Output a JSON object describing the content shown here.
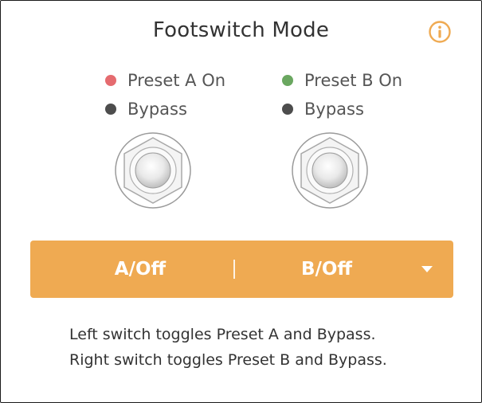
{
  "header": {
    "title": "Footswitch Mode",
    "info_icon": "info-circle-icon"
  },
  "switches": [
    {
      "states": [
        {
          "label": "Preset A On",
          "color": "#e56b6f"
        },
        {
          "label": "Bypass",
          "color": "#4d4d4d"
        }
      ],
      "icon": "footswitch-icon"
    },
    {
      "states": [
        {
          "label": "Preset B On",
          "color": "#6aa760"
        },
        {
          "label": "Bypass",
          "color": "#4d4d4d"
        }
      ],
      "icon": "footswitch-icon"
    }
  ],
  "mode_select": {
    "left_label": "A/Off",
    "separator": "|",
    "right_label": "B/Off",
    "dropdown_icon": "caret-down-icon",
    "color": "#efaa52"
  },
  "description": {
    "line1": "Left switch toggles Preset A and Bypass.",
    "line2": "Right switch toggles Preset B and Bypass."
  },
  "colors": {
    "accent": "#efaa52",
    "text": "#333333"
  }
}
